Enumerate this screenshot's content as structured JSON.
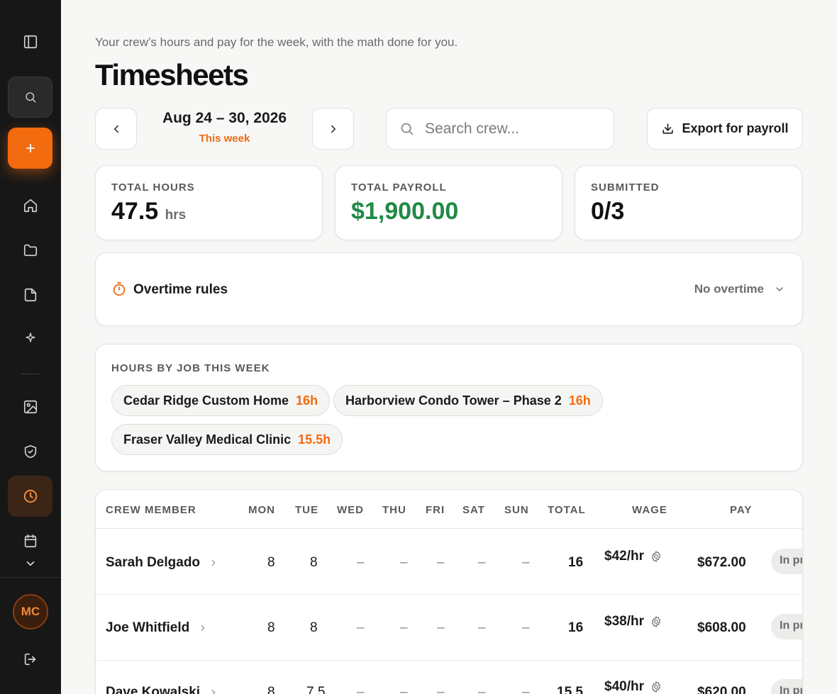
{
  "page": {
    "subtitle": "Your crew’s hours and pay for the week, with the math done for you.",
    "title": "Timesheets"
  },
  "week": {
    "range": "Aug 24 – 30, 2026",
    "label": "This week"
  },
  "search": {
    "placeholder": "Search crew..."
  },
  "toolbar": {
    "export_label": "Export for payroll"
  },
  "stats": {
    "total_hours_label": "TOTAL HOURS",
    "total_hours_value": "47.5",
    "total_hours_unit": "hrs",
    "total_payroll_label": "TOTAL PAYROLL",
    "total_payroll_value": "$1,900.00",
    "submitted_label": "SUBMITTED",
    "submitted_value": "0/3"
  },
  "overtime": {
    "title": "Overtime rules",
    "selected": "No overtime"
  },
  "jobs": {
    "label": "HOURS BY JOB THIS WEEK",
    "items": [
      {
        "name": "Cedar Ridge Custom Home",
        "hours": "16h"
      },
      {
        "name": "Harborview Condo Tower – Phase 2",
        "hours": "16h"
      },
      {
        "name": "Fraser Valley Medical Clinic",
        "hours": "15.5h"
      }
    ]
  },
  "table": {
    "headers": {
      "crew": "CREW MEMBER",
      "mon": "MON",
      "tue": "TUE",
      "wed": "WED",
      "thu": "THU",
      "fri": "FRI",
      "sat": "SAT",
      "sun": "SUN",
      "total": "TOTAL",
      "wage": "WAGE",
      "pay": "PAY"
    },
    "rows": [
      {
        "name": "Sarah Delgado",
        "mon": "8",
        "tue": "8",
        "wed": "–",
        "thu": "–",
        "fri": "–",
        "sat": "–",
        "sun": "–",
        "total": "16",
        "wage": "$42/hr",
        "pay": "$672.00",
        "status": "In pr"
      },
      {
        "name": "Joe Whitfield",
        "mon": "8",
        "tue": "8",
        "wed": "–",
        "thu": "–",
        "fri": "–",
        "sat": "–",
        "sun": "–",
        "total": "16",
        "wage": "$38/hr",
        "pay": "$608.00",
        "status": "In pr"
      },
      {
        "name": "Dave Kowalski",
        "mon": "8",
        "tue": "7.5",
        "wed": "–",
        "thu": "–",
        "fri": "–",
        "sat": "–",
        "sun": "–",
        "total": "15.5",
        "wage": "$40/hr",
        "pay": "$620.00",
        "status": "In pr"
      }
    ]
  },
  "user": {
    "initials": "MC"
  },
  "colors": {
    "accent": "#f26b0f",
    "positive": "#1f8a45",
    "sidebar": "#171717"
  },
  "sidebar_icons": [
    "sidebar-toggle-icon",
    "search-icon",
    "plus-icon",
    "home-icon",
    "folder-icon",
    "file-icon",
    "sparkle-icon",
    "image-icon",
    "shield-check-icon",
    "clock-icon",
    "calendar-icon",
    "chevron-down-icon",
    "logout-icon"
  ]
}
